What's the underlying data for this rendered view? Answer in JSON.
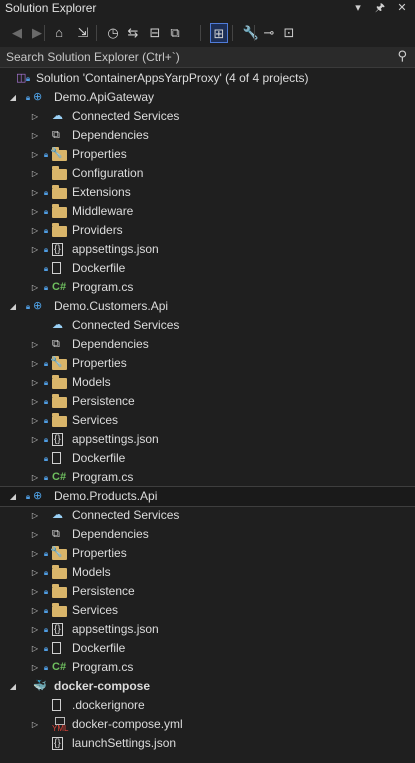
{
  "window": {
    "title": "Solution Explorer"
  },
  "title_buttons": [
    {
      "name": "dropdown-chevron-icon",
      "glyph": "▾"
    },
    {
      "name": "pin-icon",
      "glyph": "🖈"
    },
    {
      "name": "close-icon",
      "glyph": "✕"
    }
  ],
  "toolbar": [
    {
      "name": "back-icon",
      "glyph": "◀",
      "dim": true
    },
    {
      "name": "forward-icon",
      "glyph": "▶",
      "dim": true
    },
    {
      "name": "home-icon",
      "glyph": "⌂"
    },
    {
      "name": "switch-views-icon",
      "glyph": "⇲"
    },
    {
      "name": "history-icon",
      "glyph": "◷"
    },
    {
      "name": "sync-icon",
      "glyph": "⇆"
    },
    {
      "name": "collapse-all-icon",
      "glyph": "⊟"
    },
    {
      "name": "show-all-files-icon",
      "glyph": "⧉"
    },
    {
      "name": "filter-pending-changes-icon",
      "glyph": "⊞",
      "active": true
    },
    {
      "name": "properties-wrench-icon",
      "glyph": "🔧"
    },
    {
      "name": "preview-icon",
      "glyph": "⊸"
    },
    {
      "name": "class-view-icon",
      "glyph": "⊡"
    }
  ],
  "search": {
    "placeholder": "Search Solution Explorer (Ctrl+`)",
    "icon": "search-icon"
  },
  "tree": [
    {
      "label": "Solution 'ContainerAppsYarpProxy' (4 of 4 projects)",
      "icon": "solution-icon",
      "level": 0,
      "expander": "",
      "lock": true
    },
    {
      "label": "Demo.ApiGateway",
      "icon": "web-project-icon",
      "level": 0,
      "expander": "expanded",
      "lock": true
    },
    {
      "label": "Connected Services",
      "icon": "connected-services-icon",
      "level": 1,
      "expander": "collapsed",
      "lock": false
    },
    {
      "label": "Dependencies",
      "icon": "dependencies-icon",
      "level": 1,
      "expander": "collapsed",
      "lock": false
    },
    {
      "label": "Properties",
      "icon": "properties-folder-icon",
      "level": 1,
      "expander": "collapsed",
      "lock": true
    },
    {
      "label": "Configuration",
      "icon": "folder-icon",
      "level": 1,
      "expander": "collapsed",
      "lock": false
    },
    {
      "label": "Extensions",
      "icon": "folder-icon",
      "level": 1,
      "expander": "collapsed",
      "lock": true
    },
    {
      "label": "Middleware",
      "icon": "folder-icon",
      "level": 1,
      "expander": "collapsed",
      "lock": true
    },
    {
      "label": "Providers",
      "icon": "folder-icon",
      "level": 1,
      "expander": "collapsed",
      "lock": true
    },
    {
      "label": "appsettings.json",
      "icon": "json-file-icon",
      "level": 1,
      "expander": "collapsed",
      "lock": true
    },
    {
      "label": "Dockerfile",
      "icon": "file-icon",
      "level": 1,
      "expander": "",
      "lock": true
    },
    {
      "label": "Program.cs",
      "icon": "csharp-file-icon",
      "level": 1,
      "expander": "collapsed",
      "lock": true
    },
    {
      "label": "Demo.Customers.Api",
      "icon": "web-project-icon",
      "level": 0,
      "expander": "expanded",
      "lock": true
    },
    {
      "label": "Connected Services",
      "icon": "connected-services-icon",
      "level": 1,
      "expander": "",
      "lock": false
    },
    {
      "label": "Dependencies",
      "icon": "dependencies-icon",
      "level": 1,
      "expander": "collapsed",
      "lock": false
    },
    {
      "label": "Properties",
      "icon": "properties-folder-icon",
      "level": 1,
      "expander": "collapsed",
      "lock": true
    },
    {
      "label": "Models",
      "icon": "folder-icon",
      "level": 1,
      "expander": "collapsed",
      "lock": true
    },
    {
      "label": "Persistence",
      "icon": "folder-icon",
      "level": 1,
      "expander": "collapsed",
      "lock": true
    },
    {
      "label": "Services",
      "icon": "folder-icon",
      "level": 1,
      "expander": "collapsed",
      "lock": true
    },
    {
      "label": "appsettings.json",
      "icon": "json-file-icon",
      "level": 1,
      "expander": "collapsed",
      "lock": true
    },
    {
      "label": "Dockerfile",
      "icon": "file-icon",
      "level": 1,
      "expander": "",
      "lock": true
    },
    {
      "label": "Program.cs",
      "icon": "csharp-file-icon",
      "level": 1,
      "expander": "collapsed",
      "lock": true
    },
    {
      "label": "Demo.Products.Api",
      "icon": "web-project-icon",
      "level": 0,
      "expander": "expanded",
      "lock": true,
      "selected": true
    },
    {
      "label": "Connected Services",
      "icon": "connected-services-icon",
      "level": 1,
      "expander": "collapsed",
      "lock": false
    },
    {
      "label": "Dependencies",
      "icon": "dependencies-icon",
      "level": 1,
      "expander": "collapsed",
      "lock": false
    },
    {
      "label": "Properties",
      "icon": "properties-folder-icon",
      "level": 1,
      "expander": "collapsed",
      "lock": true
    },
    {
      "label": "Models",
      "icon": "folder-icon",
      "level": 1,
      "expander": "collapsed",
      "lock": true
    },
    {
      "label": "Persistence",
      "icon": "folder-icon",
      "level": 1,
      "expander": "collapsed",
      "lock": true
    },
    {
      "label": "Services",
      "icon": "folder-icon",
      "level": 1,
      "expander": "collapsed",
      "lock": true
    },
    {
      "label": "appsettings.json",
      "icon": "json-file-icon",
      "level": 1,
      "expander": "collapsed",
      "lock": true
    },
    {
      "label": "Dockerfile",
      "icon": "file-icon",
      "level": 1,
      "expander": "collapsed",
      "lock": true
    },
    {
      "label": "Program.cs",
      "icon": "csharp-file-icon",
      "level": 1,
      "expander": "collapsed",
      "lock": true
    },
    {
      "label": "docker-compose",
      "icon": "docker-icon",
      "level": 0,
      "expander": "expanded",
      "lock": false,
      "bold": true
    },
    {
      "label": ".dockerignore",
      "icon": "file-icon",
      "level": 1,
      "expander": "",
      "lock": false
    },
    {
      "label": "docker-compose.yml",
      "icon": "yaml-file-icon",
      "level": 1,
      "expander": "collapsed",
      "lock": false
    },
    {
      "label": "launchSettings.json",
      "icon": "json-file-icon",
      "level": 1,
      "expander": "",
      "lock": false
    }
  ],
  "colors": {
    "background": "#1f1f1f",
    "lock": "#4f9de3",
    "folder": "#d9b56a",
    "csharp": "#6fbf5f",
    "yaml": "#e0443a",
    "docker": "#3a9be8"
  }
}
